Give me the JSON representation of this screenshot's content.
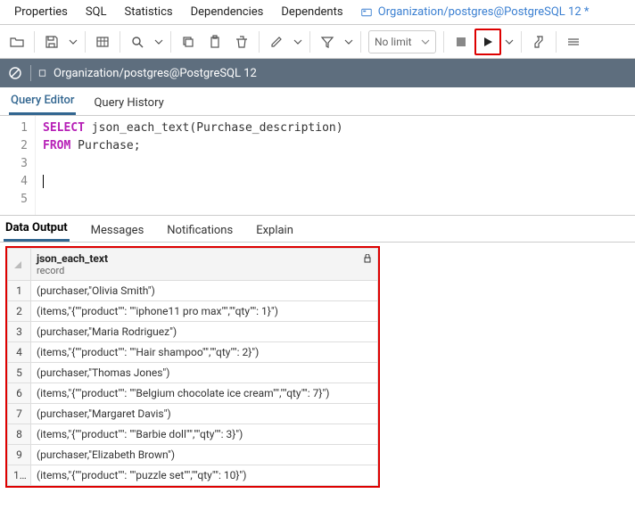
{
  "top_tabs": {
    "properties": "Properties",
    "sql": "SQL",
    "statistics": "Statistics",
    "dependencies": "Dependencies",
    "dependents": "Dependents",
    "query_tool": "Organization/postgres@PostgreSQL 12 *"
  },
  "toolbar": {
    "no_limit": "No limit"
  },
  "connection": {
    "label": "Organization/postgres@PostgreSQL 12"
  },
  "editor_tabs": {
    "query_editor": "Query Editor",
    "query_history": "Query History"
  },
  "code": {
    "line1_kw": "SELECT",
    "line1_rest": " json_each_text(Purchase_description)",
    "line2_kw": "FROM",
    "line2_rest": " Purchase;",
    "gutter": [
      "1",
      "2",
      "3",
      "4",
      "5"
    ]
  },
  "output_tabs": {
    "data_output": "Data Output",
    "messages": "Messages",
    "notifications": "Notifications",
    "explain": "Explain"
  },
  "grid": {
    "col_name": "json_each_text",
    "col_type": "record",
    "rows": [
      "(purchaser,\"Olivia Smith\")",
      "(items,\"{\"\"product\"\": \"\"iphone11 pro max\"\",\"\"qty\"\": 1}\")",
      "(purchaser,\"Maria Rodriguez\")",
      "(items,\"{\"\"product\"\": \"\"Hair shampoo\"\",\"\"qty\"\": 2}\")",
      "(purchaser,\"Thomas Jones\")",
      "(items,\"{\"\"product\"\": \"\"Belgium chocolate ice cream\"\",\"\"qty\"\": 7}\")",
      "(purchaser,\"Margaret Davis\")",
      "(items,\"{\"\"product\"\": \"\"Barbie doll\"\",\"\"qty\"\": 3}\")",
      "(purchaser,\"Elizabeth Brown\")",
      "(items,\"{\"\"product\"\": \"\"puzzle set\"\",\"\"qty\"\": 10}\")"
    ]
  }
}
